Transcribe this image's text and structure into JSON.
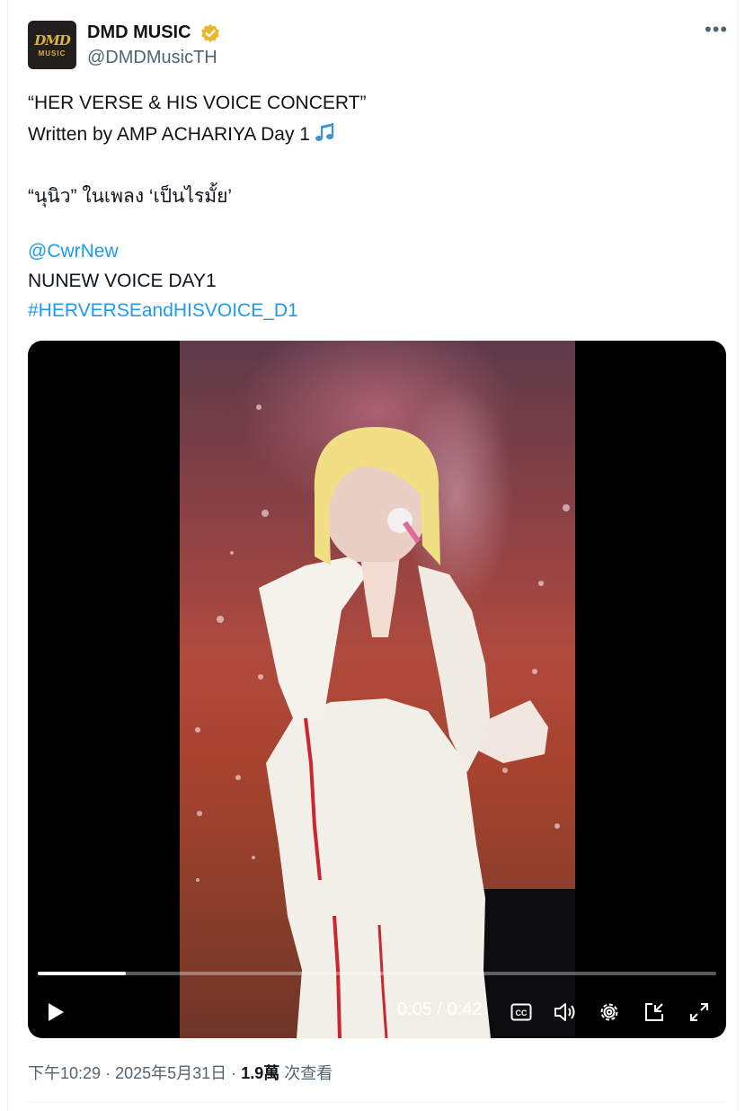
{
  "account": {
    "name": "DMD MUSIC",
    "handle": "@DMDMusicTH",
    "avatar_logo": "DMD",
    "avatar_logo_sub": "MUSIC",
    "verified_badge_color": "#e8b92d"
  },
  "tweet": {
    "line1": "“HER VERSE & HIS VOICE CONCERT”",
    "line2": "Written by AMP ACHARIYA Day 1",
    "line2_emoji": "music-notes-icon",
    "line3": "“นุนิว” ในเพลง ‘เป็นไรมั้ย’",
    "mention": "@CwrNew",
    "line5": "NUNEW VOICE DAY1",
    "hashtag": "#HERVERSEandHISVOICE_D1"
  },
  "video": {
    "current_time": "0:05",
    "separator": " / ",
    "duration": "0:42",
    "progress": 0.13,
    "controls": [
      "play-icon",
      "captions-icon",
      "volume-icon",
      "settings-icon",
      "pop-out-icon",
      "fullscreen-icon"
    ]
  },
  "meta": {
    "time": "下午10:29",
    "date": "2025年5月31日",
    "dot": "·",
    "views_count": "1.9萬",
    "views_label": "次查看"
  },
  "colors": {
    "link": "#1d9bf0",
    "secondary_text": "#536471",
    "primary_text": "#0f1419"
  }
}
